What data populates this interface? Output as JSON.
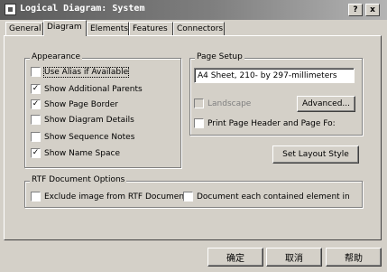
{
  "window": {
    "title": "Logical Diagram: System",
    "help_label": "?",
    "close_label": "x"
  },
  "tabs": [
    {
      "label": "General",
      "active": false
    },
    {
      "label": "Diagram",
      "active": true
    },
    {
      "label": "Elements",
      "active": false
    },
    {
      "label": "Features",
      "active": false
    },
    {
      "label": "Connectors",
      "active": false
    }
  ],
  "appearance": {
    "title": "Appearance",
    "options": [
      {
        "label": "Use Alias if Available",
        "checked": false
      },
      {
        "label": "Show Additional Parents",
        "checked": true
      },
      {
        "label": "Show Page Border",
        "checked": true
      },
      {
        "label": "Show Diagram Details",
        "checked": false
      },
      {
        "label": "Show Sequence Notes",
        "checked": false
      },
      {
        "label": "Show Name Space",
        "checked": true
      }
    ]
  },
  "page_setup": {
    "title": "Page Setup",
    "paper_value": "A4 Sheet, 210- by 297-millimeters",
    "landscape_label": "Landscape",
    "landscape_checked": false,
    "advanced_label": "Advanced...",
    "print_header_label": "Print Page Header and Page Fo:",
    "print_header_checked": false
  },
  "set_layout_label": "Set Layout Style",
  "rtf": {
    "title": "RTF Document Options",
    "exclude_label": "Exclude image from RTF Documents",
    "exclude_checked": false,
    "document_each_label": "Document each contained element in",
    "document_each_checked": false
  },
  "footer": {
    "ok_label": "确定",
    "cancel_label": "取消",
    "help_label": "帮助"
  },
  "check_glyph": "✓"
}
